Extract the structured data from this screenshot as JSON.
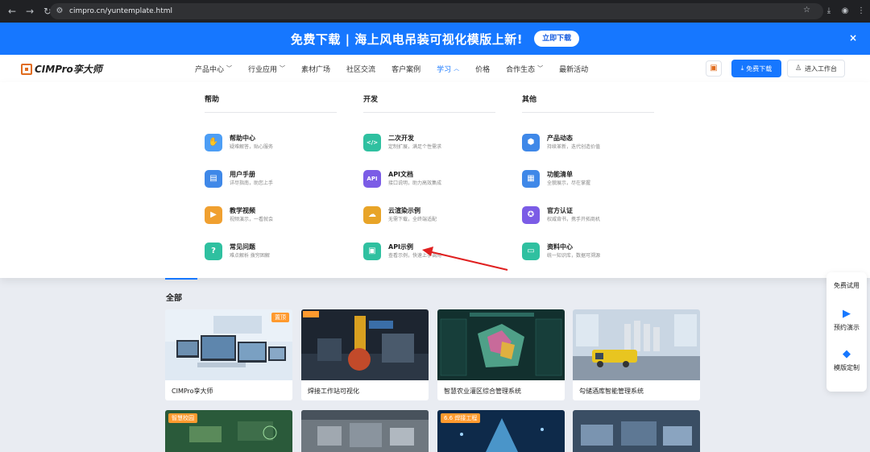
{
  "browser": {
    "url": "cimpro.cn/yuntemplate.html"
  },
  "banner": {
    "text": "免费下载 | 海上风电吊装可视化模版上新!",
    "button": "立即下载",
    "close": "×"
  },
  "header": {
    "logo": "CIMPro孪大师",
    "menu": [
      {
        "label": "产品中心",
        "dropdown": true,
        "active": false
      },
      {
        "label": "行业应用",
        "dropdown": true,
        "active": false
      },
      {
        "label": "素材广场",
        "dropdown": false,
        "active": false
      },
      {
        "label": "社区交流",
        "dropdown": false,
        "active": false
      },
      {
        "label": "客户案例",
        "dropdown": false,
        "active": false
      },
      {
        "label": "学习",
        "dropdown": true,
        "active": true
      },
      {
        "label": "价格",
        "dropdown": false,
        "active": false
      },
      {
        "label": "合作生态",
        "dropdown": true,
        "active": false
      },
      {
        "label": "最新活动",
        "dropdown": false,
        "active": false
      }
    ],
    "download_button": "免费下载",
    "workspace_button": "进入工作台"
  },
  "mega_menu": {
    "columns": [
      {
        "heading": "帮助",
        "items": [
          {
            "title": "帮助中心",
            "desc": "疑难解答，贴心服务",
            "icon": "handshake-icon",
            "color": "#4d9ef5"
          },
          {
            "title": "用户手册",
            "desc": "详尽指南，助您上手",
            "icon": "book-icon",
            "color": "#3f88e8"
          },
          {
            "title": "教学视频",
            "desc": "视频演示，一看就会",
            "icon": "video-folder-icon",
            "color": "#f0a030"
          },
          {
            "title": "常见问题",
            "desc": "难点解析 拨穷困解",
            "icon": "question-icon",
            "color": "#2fc0a0"
          }
        ]
      },
      {
        "heading": "开发",
        "items": [
          {
            "title": "二次开发",
            "desc": "定制扩展，满足个性需求",
            "icon": "code-icon",
            "color": "#2fc0a0"
          },
          {
            "title": "API文档",
            "desc": "接口说明，助力高效集成",
            "icon": "api-icon",
            "color": "#7b5ce6"
          },
          {
            "title": "云渲染示例",
            "desc": "无需下载，全终端适配",
            "icon": "cloud-icon",
            "color": "#e8a428"
          },
          {
            "title": "API示例",
            "desc": "查看示例，快速上手调用",
            "icon": "api-example-icon",
            "color": "#2fc0a0"
          }
        ]
      },
      {
        "heading": "其他",
        "items": [
          {
            "title": "产品动态",
            "desc": "持续革新，迭代创造价值",
            "icon": "product-news-icon",
            "color": "#3f88e8"
          },
          {
            "title": "功能清单",
            "desc": "全貌展示，尽在掌握",
            "icon": "grid-icon",
            "color": "#3f88e8"
          },
          {
            "title": "官方认证",
            "desc": "权威背书，携手开拓商机",
            "icon": "certificate-icon",
            "color": "#7b5ce6"
          },
          {
            "title": "资料中心",
            "desc": "统一知识库，数据可溯源",
            "icon": "archive-icon",
            "color": "#2fc0a0"
          }
        ]
      }
    ]
  },
  "content": {
    "section_title": "全部",
    "cards": [
      {
        "caption": "CIMPro孪大师",
        "tag": "置顶"
      },
      {
        "caption": "焊接工作站可视化",
        "tag": ""
      },
      {
        "caption": "智慧农业灌区综合管理系统",
        "tag": ""
      },
      {
        "caption": "勾储酒库智能管理系统",
        "tag": ""
      }
    ],
    "cards_row2": [
      {
        "tag": "智慧校园"
      },
      {
        "tag": ""
      },
      {
        "tag": "6.6 焊接工程"
      },
      {
        "tag": ""
      }
    ]
  },
  "float_toolbar": [
    {
      "label": "免费试用",
      "icon": "trial-icon"
    },
    {
      "label": "预约演示",
      "icon": "play-icon"
    },
    {
      "label": "模版定制",
      "icon": "diamond-icon"
    }
  ],
  "colors": {
    "primary": "#1677ff",
    "accent": "#e06c1e"
  }
}
